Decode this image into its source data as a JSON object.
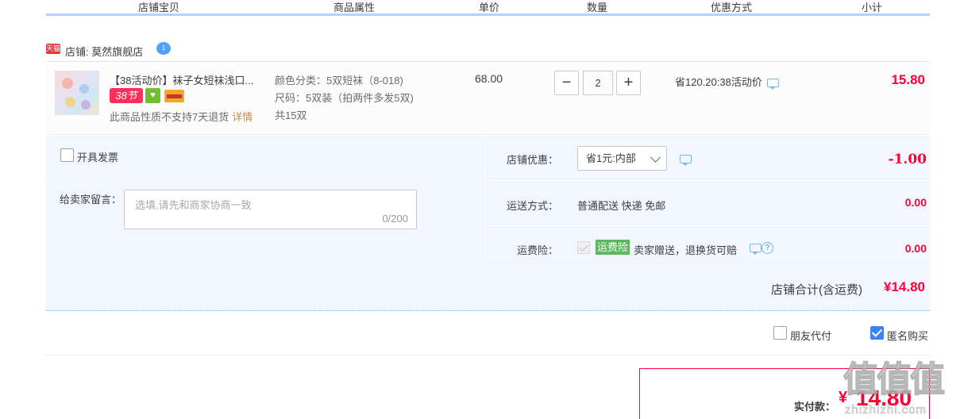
{
  "table_header": {
    "columns": [
      "店铺宝贝",
      "商品属性",
      "单价",
      "数量",
      "优惠方式",
      "小计"
    ]
  },
  "shop": {
    "badge": "天猫",
    "label": "店铺: 莫然旗舰店",
    "chat_count": "1"
  },
  "item": {
    "title": "【38活动价】袜子女短袜浅口...",
    "badge_38": "38节",
    "no_return": "此商品性质不支持7天退货",
    "details_link": "详情",
    "props": [
      "颜色分类：5双短袜（8-018)",
      "尺码：5双装（拍两件多发5双)",
      "共15双"
    ],
    "unit_price": "68.00",
    "quantity": "2",
    "qty_minus": "−",
    "qty_plus": "+",
    "discount": "省120.20:38活动价",
    "subtotal": "15.80"
  },
  "options": {
    "invoice_label": "开具发票",
    "message_label": "给卖家留言：",
    "message_placeholder": "选填,请先和商家协商一致",
    "message_count": "0/200",
    "shop_discount_label": "店铺优惠：",
    "shop_discount_value": "省1元:内部",
    "shop_discount_amount": "-1.00",
    "shipping_label": "运送方式：",
    "shipping_value": "普通配送 快递 免邮",
    "shipping_amount": "0.00",
    "insurance_label": "运费险：",
    "insurance_tag": "运费险",
    "insurance_text": "卖家赠送，退换货可赔",
    "insurance_amount": "0.00",
    "help_glyph": "?",
    "shop_total_label": "店铺合计(含运费)",
    "shop_total_value": "¥14.80"
  },
  "extras": {
    "friend_pay": "朋友代付",
    "anonymous": "匿名购买",
    "anonymous_checked": true
  },
  "payment": {
    "label": "实付款：",
    "currency": "¥",
    "amount": "14.80"
  },
  "watermark": {
    "big": "值值值",
    "small": "zhizhizhi.com"
  },
  "colors": {
    "accent_red": "#ff0036",
    "header_line": "#b2d1ff",
    "options_bg": "#f2f7ff",
    "checkbox_blue": "#3b82f6",
    "insurance_green": "#5cb85c"
  }
}
